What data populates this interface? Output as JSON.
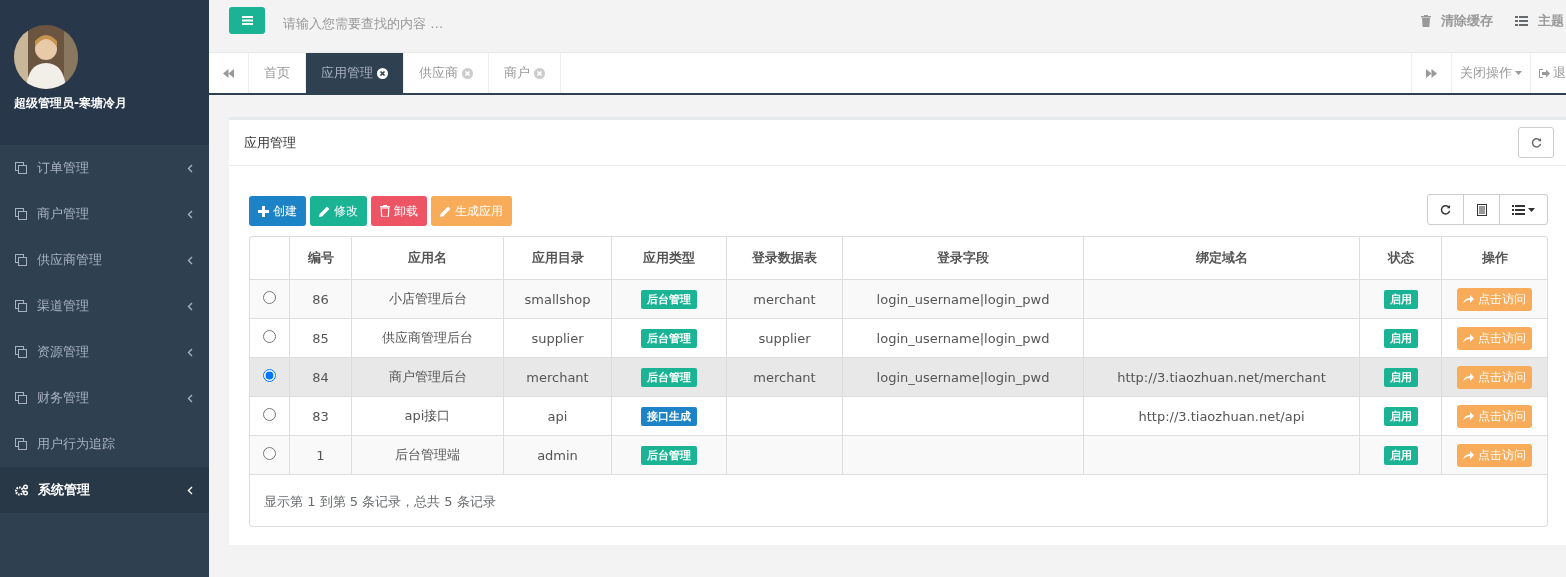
{
  "user": {
    "name": "超级管理员-寒塘冷月"
  },
  "sidebar": {
    "items": [
      {
        "label": "订单管理",
        "kind": "module",
        "expandable": true,
        "selected": false
      },
      {
        "label": "商户管理",
        "kind": "module",
        "expandable": true,
        "selected": false
      },
      {
        "label": "供应商管理",
        "kind": "module",
        "expandable": true,
        "selected": false
      },
      {
        "label": "渠道管理",
        "kind": "module",
        "expandable": true,
        "selected": false
      },
      {
        "label": "资源管理",
        "kind": "module",
        "expandable": true,
        "selected": false
      },
      {
        "label": "财务管理",
        "kind": "module",
        "expandable": true,
        "selected": false
      },
      {
        "label": "用户行为追踪",
        "kind": "module",
        "expandable": false,
        "selected": false
      },
      {
        "label": "系统管理",
        "kind": "system",
        "expandable": true,
        "selected": true
      }
    ]
  },
  "topbar": {
    "search": {
      "placeholder": "请输入您需要查找的内容 …"
    },
    "actions": [
      "清除缓存",
      "主题"
    ]
  },
  "tabs": {
    "items": [
      {
        "label": "首页",
        "closable": false,
        "selected": false
      },
      {
        "label": "应用管理",
        "closable": true,
        "selected": true
      },
      {
        "label": "供应商",
        "closable": true,
        "selected": false
      },
      {
        "label": "商户",
        "closable": true,
        "selected": false
      }
    ],
    "close_menu": "关闭操作",
    "logout": "退"
  },
  "panel": {
    "title": "应用管理",
    "toolbar": [
      {
        "label": "创建",
        "kind": "create"
      },
      {
        "label": "修改",
        "kind": "edit"
      },
      {
        "label": "卸载",
        "kind": "delete"
      },
      {
        "label": "生成应用",
        "kind": "generate"
      }
    ],
    "table": {
      "columns": [
        "编号",
        "应用名",
        "应用目录",
        "应用类型",
        "登录数据表",
        "登录字段",
        "绑定域名",
        "状态",
        "操作"
      ],
      "rows": [
        {
          "selected": false,
          "id": "86",
          "name": "小店管理后台",
          "dir": "smallshop",
          "type": {
            "label": "后台管理",
            "kind": "admin"
          },
          "login_table": "merchant",
          "login_fields": "login_username|login_pwd",
          "status": "启用",
          "action": "点击访问"
        },
        {
          "selected": false,
          "id": "85",
          "name": "供应商管理后台",
          "dir": "supplier",
          "type": {
            "label": "后台管理",
            "kind": "admin"
          },
          "login_table": "supplier",
          "login_fields": "login_username|login_pwd",
          "status": "启用",
          "action": "点击访问"
        },
        {
          "selected": true,
          "id": "84",
          "name": "商户管理后台",
          "dir": "merchant",
          "type": {
            "label": "后台管理",
            "kind": "admin"
          },
          "login_table": "merchant",
          "login_fields": "login_username|login_pwd",
          "domain": "http://3.tiaozhuan.net/merchant",
          "status": "启用",
          "action": "点击访问"
        },
        {
          "selected": false,
          "id": "83",
          "name": "api接口",
          "dir": "api",
          "type": {
            "label": "接口生成",
            "kind": "api"
          },
          "domain": "http://3.tiaozhuan.net/api",
          "status": "启用",
          "action": "点击访问"
        },
        {
          "selected": false,
          "id": "1",
          "name": "后台管理端",
          "dir": "admin",
          "type": {
            "label": "后台管理",
            "kind": "admin"
          },
          "status": "启用",
          "action": "点击访问"
        }
      ]
    },
    "footer": "显示第 1 到第 5 条记录，总共 5 条记录"
  }
}
